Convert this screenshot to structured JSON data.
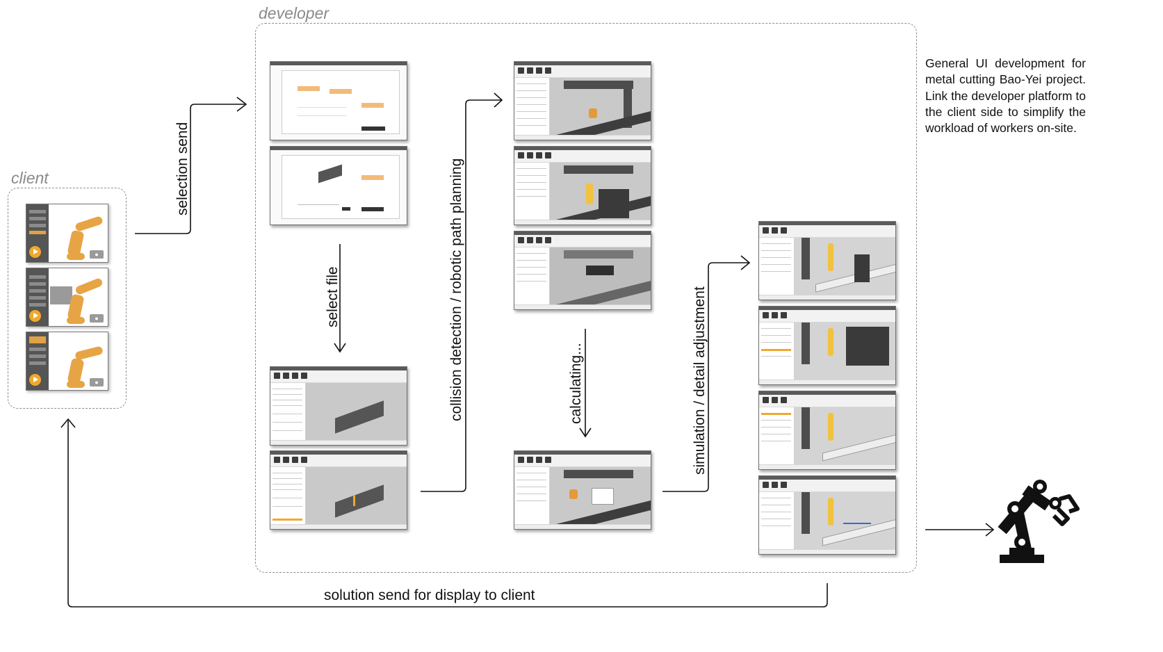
{
  "labels": {
    "client": "client",
    "developer": "developer",
    "selection_send": "selection send",
    "select_file": "select file",
    "collision": "collision detection / robotic path planning",
    "calculating": "calculating...",
    "simulation": "simulation / detail adjustment",
    "solution": "solution send for display to client"
  },
  "description": "General UI development for metal cutting  Bao-Yei project. Link the developer platform to the client side to simplify the workload of workers on-site.",
  "icons": {
    "robot_arm": "robot-arm-icon",
    "camera": "camera-icon",
    "play": "play-icon"
  },
  "colors": {
    "accent_orange": "#f0a830",
    "dashed_border": "#8c8c8c",
    "group_label": "#8a8a8a"
  }
}
